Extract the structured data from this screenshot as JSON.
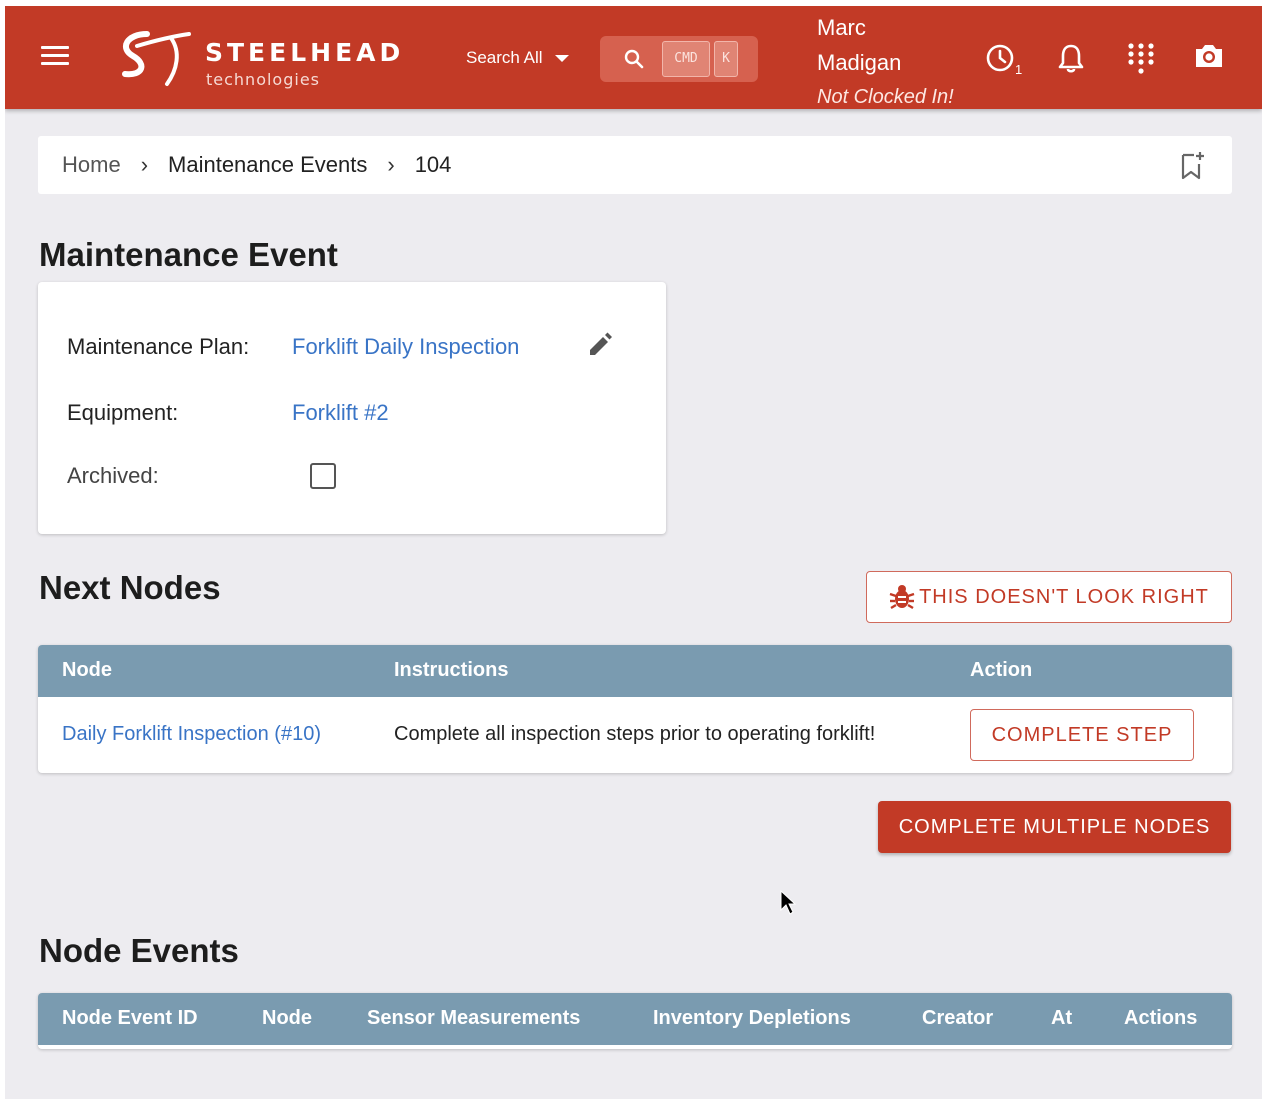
{
  "header": {
    "brand_name": "STEELHEAD",
    "brand_sub": "technologies",
    "search_all_label": "Search All",
    "kbd_cmd": "CMD",
    "kbd_k": "K",
    "user_first": "Marc",
    "user_last": "Madigan",
    "clock_status": "Not Clocked In!",
    "clock_count": "1",
    "accent_color": "#c23a26"
  },
  "breadcrumb": {
    "items": [
      "Home",
      "Maintenance Events",
      "104"
    ]
  },
  "maintenance_event": {
    "title": "Maintenance Event",
    "plan_label": "Maintenance Plan:",
    "plan_value": "Forklift Daily Inspection",
    "equipment_label": "Equipment:",
    "equipment_value": "Forklift #2",
    "archived_label": "Archived:",
    "archived": false
  },
  "next_nodes": {
    "title": "Next Nodes",
    "report_button": "THIS DOESN'T LOOK RIGHT",
    "columns": [
      "Node",
      "Instructions",
      "Action"
    ],
    "rows": [
      {
        "node": "Daily Forklift Inspection (#10)",
        "instructions": "Complete all inspection steps prior to operating forklift!",
        "action": "COMPLETE STEP"
      }
    ],
    "complete_multiple_button": "COMPLETE MULTIPLE NODES"
  },
  "node_events": {
    "title": "Node Events",
    "columns": [
      "Node Event ID",
      "Node",
      "Sensor Measurements",
      "Inventory Depletions",
      "Creator",
      "At",
      "Actions"
    ]
  }
}
